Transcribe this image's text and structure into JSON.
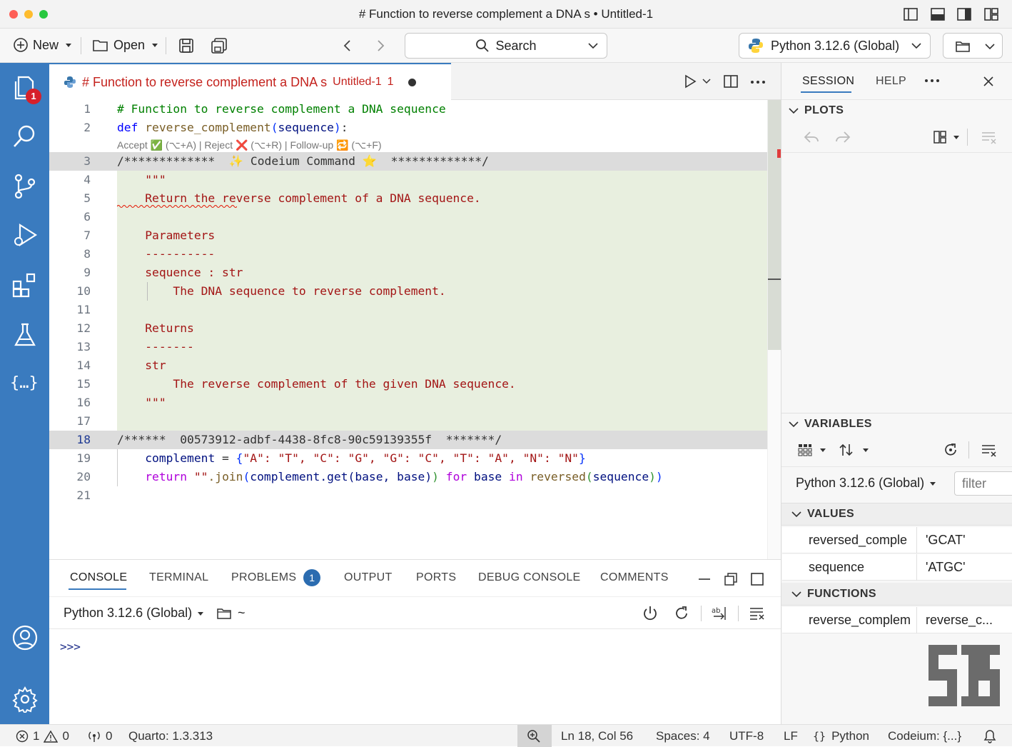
{
  "window": {
    "title": "# Function to reverse complement a DNA s • Untitled-1"
  },
  "toolbar": {
    "new_label": "New",
    "open_label": "Open",
    "search_label": "Search",
    "interpreter": "Python 3.12.6 (Global)"
  },
  "activity": {
    "explorer_badge": "1"
  },
  "editor_tab": {
    "title": "# Function to reverse complement a DNA s",
    "file": "Untitled-1",
    "problems": "1"
  },
  "codelens": {
    "text": "Accept ✅ (⌥+A) | Reject ❌ (⌥+R) | Follow-up 🔁 (⌥+F)"
  },
  "code": {
    "line_numbers": [
      "1",
      "2",
      "3",
      "4",
      "5",
      "6",
      "7",
      "8",
      "9",
      "10",
      "11",
      "12",
      "13",
      "14",
      "15",
      "16",
      "17",
      "18",
      "19",
      "20",
      "21"
    ],
    "l1": "# Function to reverse complement a DNA sequence",
    "l2_def": "def",
    "l2_name": "reverse_complement",
    "l2_param": "sequence",
    "l3": "/*************  ✨ Codeium Command ⭐  *************/",
    "l4": "    \"\"\"",
    "l5": "    Return the reverse complement of a DNA sequence.",
    "l7": "    Parameters",
    "l8": "    ----------",
    "l9": "    sequence : str",
    "l10": "        The DNA sequence to reverse complement.",
    "l12": "    Returns",
    "l13": "    -------",
    "l14": "    str",
    "l15": "        The reverse complement of the given DNA sequence.",
    "l16": "    \"\"\"",
    "l18": "/******  00573912-adbf-4438-8fc8-90c59139355f  *******/",
    "l19_var": "complement",
    "l19_pairs": "\"A\": \"T\", \"C\": \"G\", \"G\": \"C\", \"T\": \"A\", \"N\": \"N\"",
    "l20_return": "return",
    "l20_str": "\"\"",
    "l20_join": ".join",
    "l20_args": "complement.get(base, base)",
    "l20_for": "for",
    "l20_base": "base",
    "l20_in": "in",
    "l20_rev": "reversed",
    "l20_seq": "sequence"
  },
  "panel": {
    "tabs": [
      "CONSOLE",
      "TERMINAL",
      "PROBLEMS",
      "OUTPUT",
      "PORTS",
      "DEBUG CONSOLE",
      "COMMENTS"
    ],
    "problems_count": "1",
    "interpreter": "Python 3.12.6 (Global)",
    "cwd": "~",
    "prompt": ">>>"
  },
  "right": {
    "tabs": [
      "SESSION",
      "HELP"
    ],
    "plots_header": "PLOTS",
    "variables_header": "VARIABLES",
    "interpreter": "Python 3.12.6 (Global)",
    "filter_placeholder": "filter",
    "values_header": "VALUES",
    "functions_header": "FUNCTIONS",
    "values": [
      {
        "name": "reversed_comple",
        "value": "'GCAT'"
      },
      {
        "name": "sequence",
        "value": "'ATGC'"
      }
    ],
    "functions": [
      {
        "name": "reverse_complem",
        "value": "reverse_c..."
      }
    ]
  },
  "status": {
    "errors": "1",
    "warnings": "0",
    "ports": "0",
    "quarto": "Quarto: 1.3.313",
    "position": "Ln 18, Col 56",
    "spaces": "Spaces: 4",
    "encoding": "UTF-8",
    "eol": "LF",
    "language": "Python",
    "codeium": "Codeium: {...}"
  },
  "colors": {
    "accent": "#3a7bbf",
    "error": "#d6202a",
    "string": "#a31515",
    "keyword": "#0000ff",
    "comment": "#008000"
  }
}
